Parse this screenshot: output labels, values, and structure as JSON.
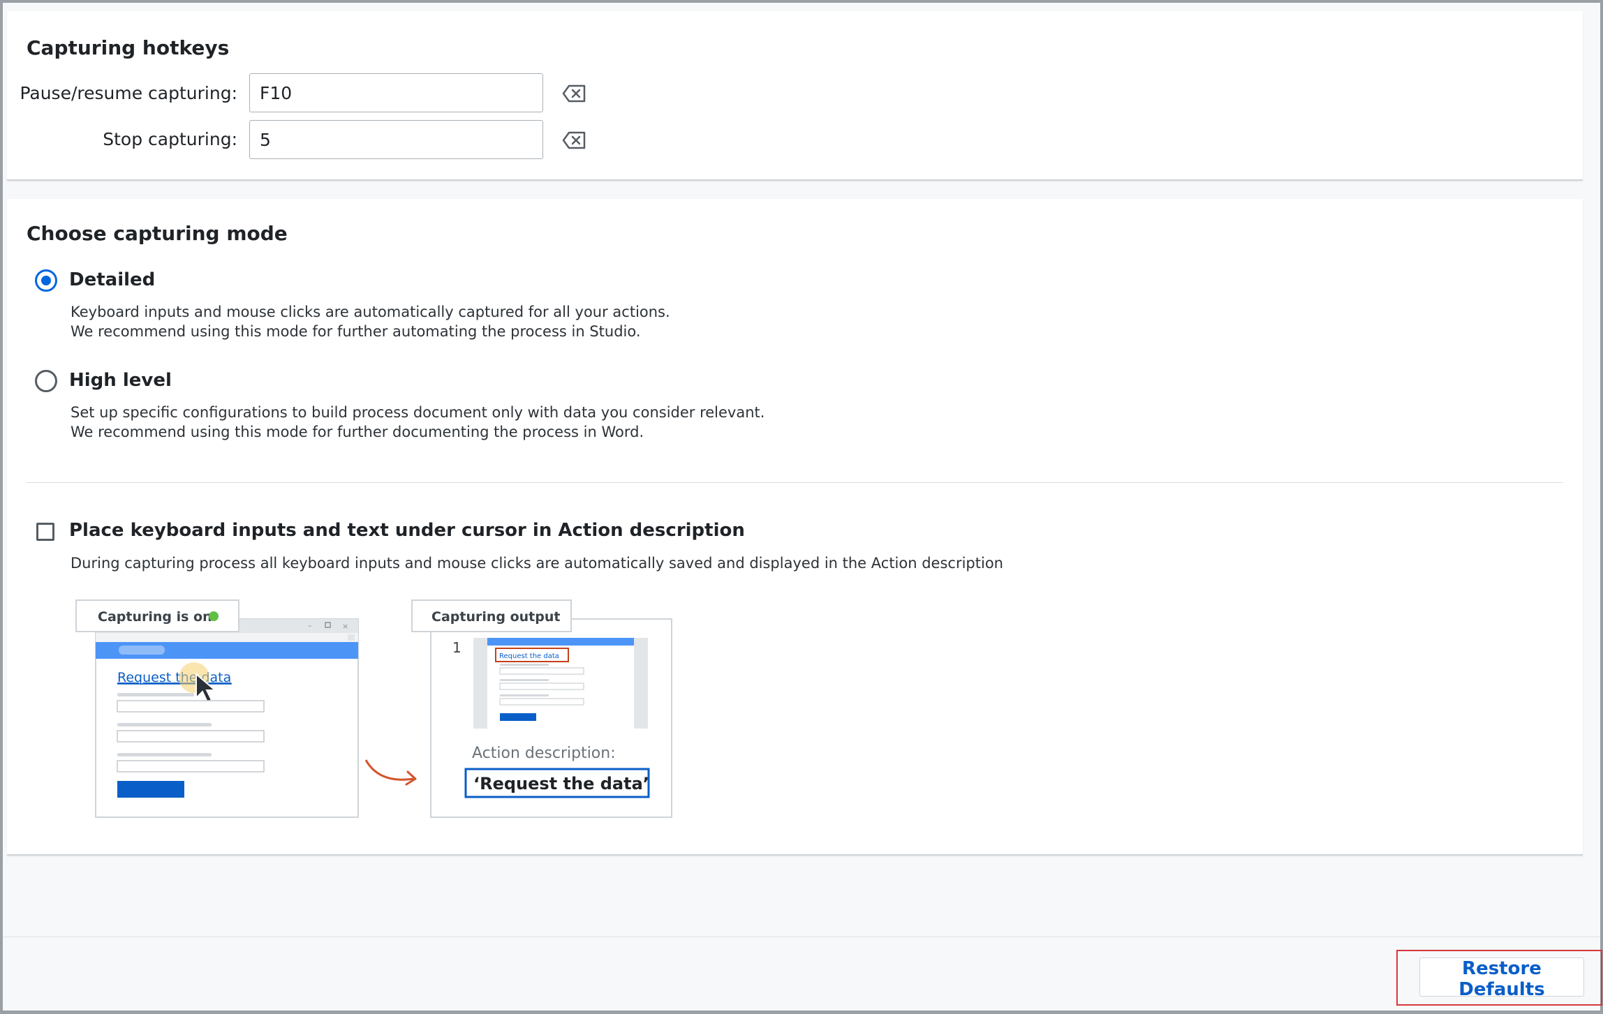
{
  "hotkeys": {
    "title": "Capturing hotkeys",
    "pause_label": "Pause/resume capturing:",
    "pause_value": "F10",
    "stop_label": "Stop capturing:",
    "stop_value": "5"
  },
  "mode": {
    "title": "Choose capturing mode",
    "options": [
      {
        "label": "Detailed",
        "selected": true,
        "desc1": "Keyboard inputs and mouse clicks are automatically captured for all your actions.",
        "desc2": "We recommend using this mode for further automating the process in Studio."
      },
      {
        "label": "High level",
        "selected": false,
        "desc1": "Set up specific configurations to build process document only with data you consider relevant.",
        "desc2": "We recommend using this mode for further documenting the process in Word."
      }
    ],
    "checkbox_label": "Place keyboard inputs and text under cursor in Action description",
    "checkbox_checked": false,
    "checkbox_desc": "During capturing process all keyboard inputs and mouse clicks are automatically saved and displayed in the Action description"
  },
  "illustration": {
    "capturing_tab": "Capturing is on",
    "link_text": "Request the data",
    "output_tab": "Capturing output",
    "step_number": "1",
    "mini_label": "Request the data",
    "action_label": "Action description:",
    "action_value": "‘Request the data’",
    "colors": {
      "accent": "#4d94f7",
      "button": "#0a5ec8",
      "status": "#5fbf45",
      "arrow": "#d2542e",
      "highlight": "#c4401b"
    }
  },
  "footer": {
    "restore_label": "Restore Defaults"
  }
}
